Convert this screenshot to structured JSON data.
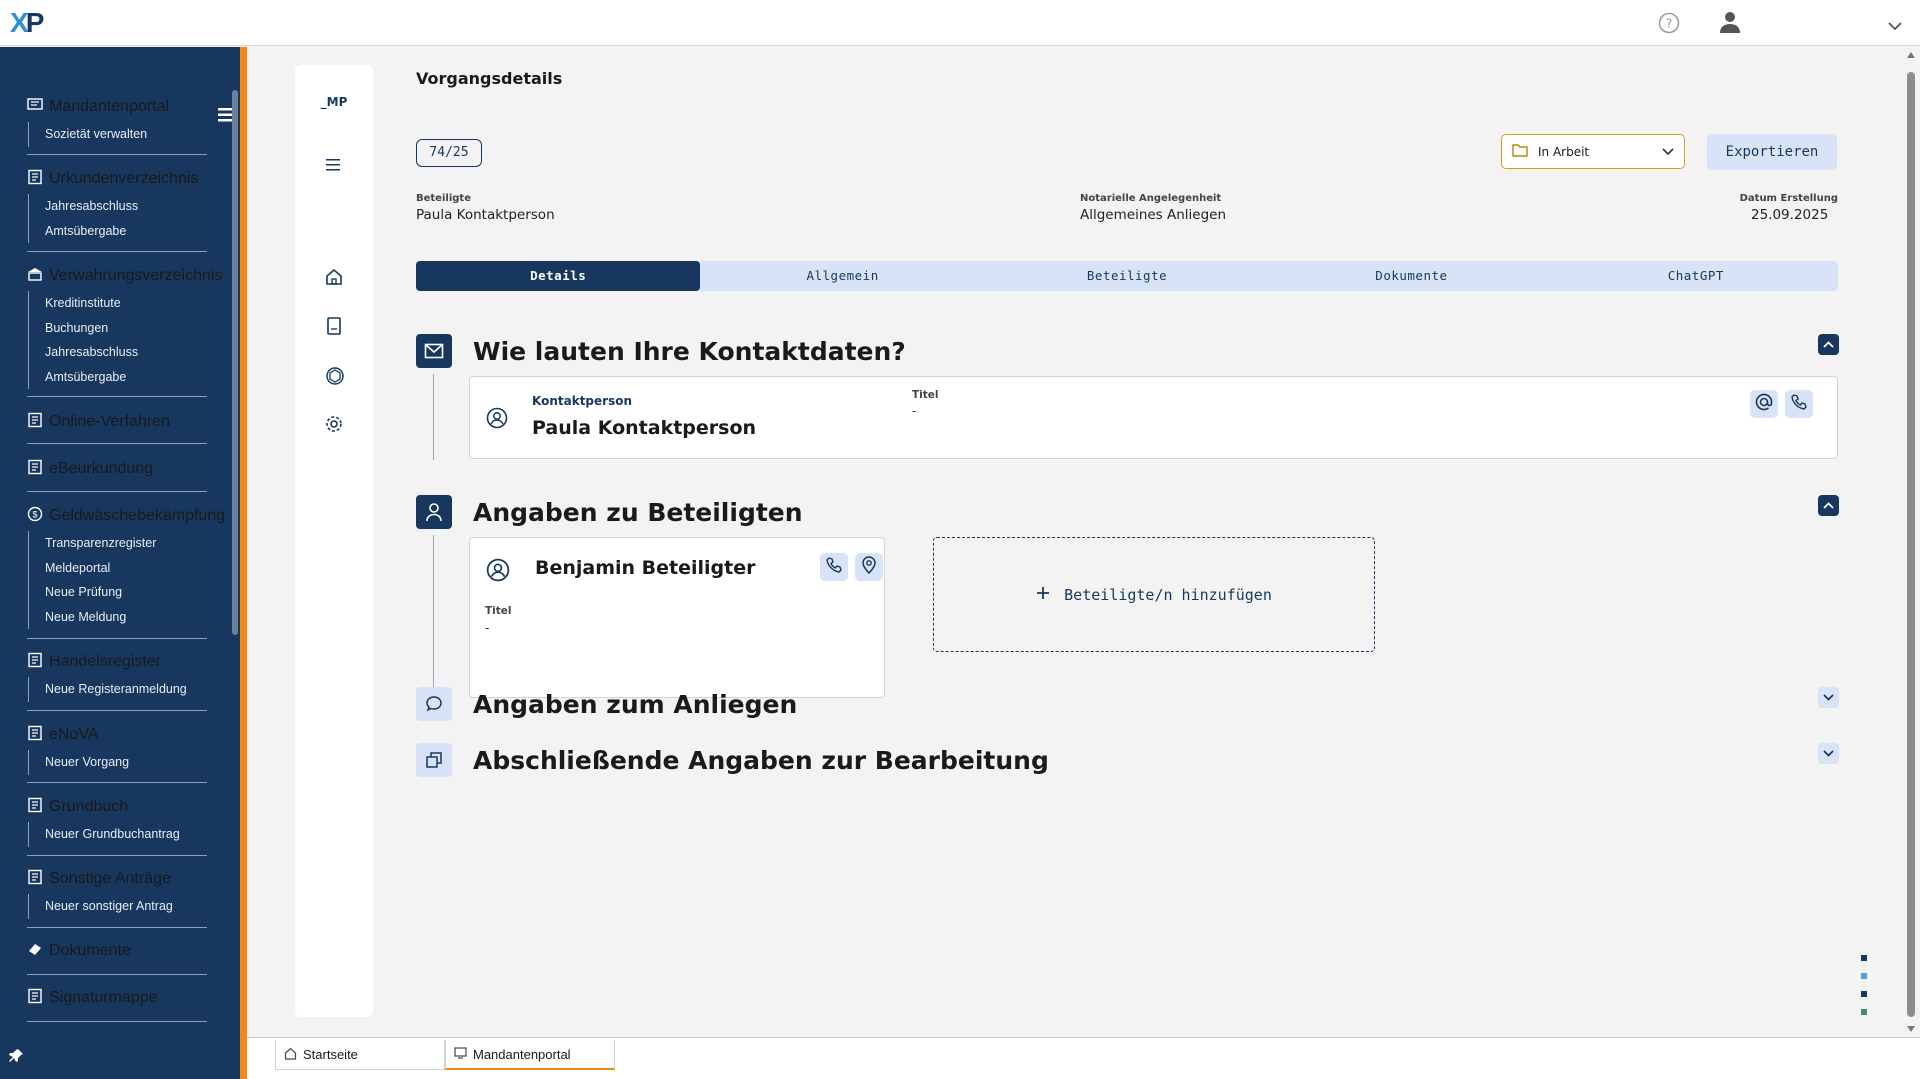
{
  "app": {
    "logo": "XP"
  },
  "nav": {
    "sections": [
      {
        "label": "Mandantenportal",
        "icon": "portal-icon",
        "items": [
          "Sozietät verwalten"
        ]
      },
      {
        "label": "Urkundenverzeichnis",
        "icon": "document-register-icon",
        "items": [
          "Jahresabschluss",
          "Amtsübergabe"
        ]
      },
      {
        "label": "Verwahrungsverzeichnis",
        "icon": "bank-icon",
        "items": [
          "Kreditinstitute",
          "Buchungen",
          "Jahresabschluss",
          "Amtsübergabe"
        ]
      },
      {
        "label": "Online-Verfahren",
        "icon": "online-procedure-icon",
        "items": []
      },
      {
        "label": "eBeurkundung",
        "icon": "e-certification-icon",
        "items": []
      },
      {
        "label": "Geldwäschebekämpfung",
        "icon": "money-laundering-icon",
        "items": [
          "Transparenzregister",
          "Meldeportal",
          "Neue Prüfung",
          "Neue Meldung"
        ]
      },
      {
        "label": "Handelsregister",
        "icon": "register-icon",
        "items": [
          "Neue Registeranmeldung"
        ]
      },
      {
        "label": "eNoVA",
        "icon": "enova-icon",
        "items": [
          "Neuer Vorgang"
        ]
      },
      {
        "label": "Grundbuch",
        "icon": "land-register-icon",
        "items": [
          "Neuer Grundbuchantrag"
        ]
      },
      {
        "label": "Sonstige Anträge",
        "icon": "other-requests-icon",
        "items": [
          "Neuer sonstiger Antrag"
        ]
      },
      {
        "label": "Dokumente",
        "icon": "documents-icon",
        "items": []
      },
      {
        "label": "Signaturmappe",
        "icon": "signature-folder-icon",
        "items": []
      }
    ]
  },
  "rail": {
    "label": "_MP"
  },
  "page": {
    "title": "Vorgangsdetails",
    "case_number": "74/25",
    "status": "In Arbeit",
    "export_label": "Exportieren",
    "meta": {
      "participants_label": "Beteiligte",
      "participants_value": "Paula Kontaktperson",
      "matter_label": "Notarielle Angelegenheit",
      "matter_value": "Allgemeines Anliegen",
      "created_label": "Datum Erstellung",
      "created_value": "25.09.2025"
    },
    "tabs": [
      "Details",
      "Allgemein",
      "Beteiligte",
      "Dokumente",
      "ChatGPT"
    ],
    "active_tab": "Details"
  },
  "contact_section": {
    "title": "Wie lauten Ihre Kontaktdaten?",
    "role_label": "Kontaktperson",
    "name": "Paula Kontaktperson",
    "title_label": "Titel",
    "title_value": "-"
  },
  "participants_section": {
    "title": "Angaben zu Beteiligten",
    "participant_name": "Benjamin Beteiligter",
    "title_label": "Titel",
    "title_value": "-",
    "add_label": "Beteiligte/n hinzufügen"
  },
  "matter_section": {
    "title": "Angaben zum Anliegen"
  },
  "final_section": {
    "title": "Abschließende Angaben zur Bearbeitung"
  },
  "footer": {
    "tabs": [
      "Startseite",
      "Mandantenportal"
    ],
    "active_tab": "Mandantenportal"
  },
  "colors": {
    "primary": "#17375e",
    "accent": "#ef8a17",
    "light": "#d9e3f7",
    "status_border": "#d4a017"
  }
}
